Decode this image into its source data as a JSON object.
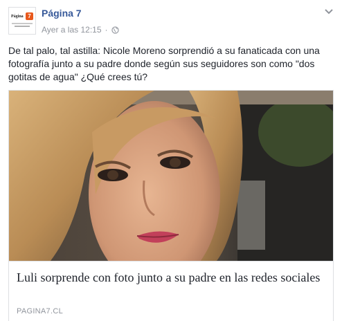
{
  "post": {
    "page_name": "Página 7",
    "timestamp": "Ayer a las 12:15",
    "separator": "·",
    "privacy_icon": "globe-icon",
    "menu_icon": "chevron-down-icon",
    "avatar": {
      "logo_word": "Página",
      "logo_badge": "7"
    },
    "text": "De tal palo, tal astilla: Nicole Moreno sorprendió a su fanaticada con una fotografía junto a su padre donde según sus seguidores son como \"dos gotitas de agua\" ¿Qué crees tú?",
    "link": {
      "title": "Luli sorprende con foto junto a su padre en las redes sociales",
      "domain": "PAGINA7.CL"
    }
  },
  "colors": {
    "page_name": "#365899",
    "meta": "#90949c",
    "text": "#1d2129",
    "border": "#dddfe2",
    "logo_badge": "#e8581c"
  }
}
